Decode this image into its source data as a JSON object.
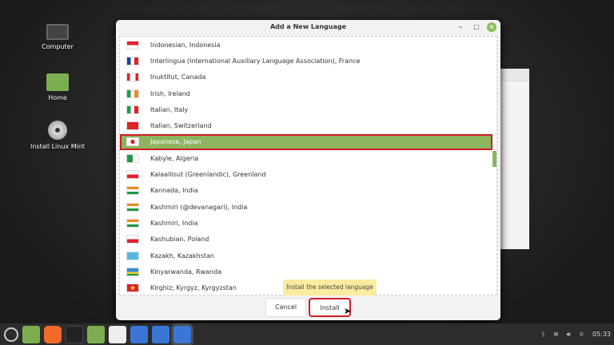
{
  "desktop": {
    "icons": [
      {
        "label": "Computer"
      },
      {
        "label": "Home"
      },
      {
        "label": "Install Linux Mint"
      }
    ]
  },
  "dialog": {
    "title": "Add a New Language",
    "languages": [
      {
        "label": "Indonesian, Indonesia"
      },
      {
        "label": "Interlingua (International Auxiliary Language Association), France"
      },
      {
        "label": "Inuktitut, Canada"
      },
      {
        "label": "Irish, Ireland"
      },
      {
        "label": "Italian, Italy"
      },
      {
        "label": "Italian, Switzerland"
      },
      {
        "label": "Japanese, Japan",
        "selected": true
      },
      {
        "label": "Kabyle, Algeria"
      },
      {
        "label": "Kalaallisut (Greenlandic), Greenland"
      },
      {
        "label": "Kannada, India"
      },
      {
        "label": "Kashmiri (@devanagari), India"
      },
      {
        "label": "Kashmiri, India"
      },
      {
        "label": "Kashubian, Poland"
      },
      {
        "label": "Kazakh, Kazakhstan"
      },
      {
        "label": "Kinyarwanda, Rwanda"
      },
      {
        "label": "Kirghiz; Kyrgyz, Kyrgyzstan"
      }
    ],
    "cancel_label": "Cancel",
    "install_label": "Install",
    "tooltip": "Install the selected language",
    "selection_color": "#8db45f",
    "highlight_color": "#d01c24"
  },
  "taskbar": {
    "clock": "05:33"
  }
}
